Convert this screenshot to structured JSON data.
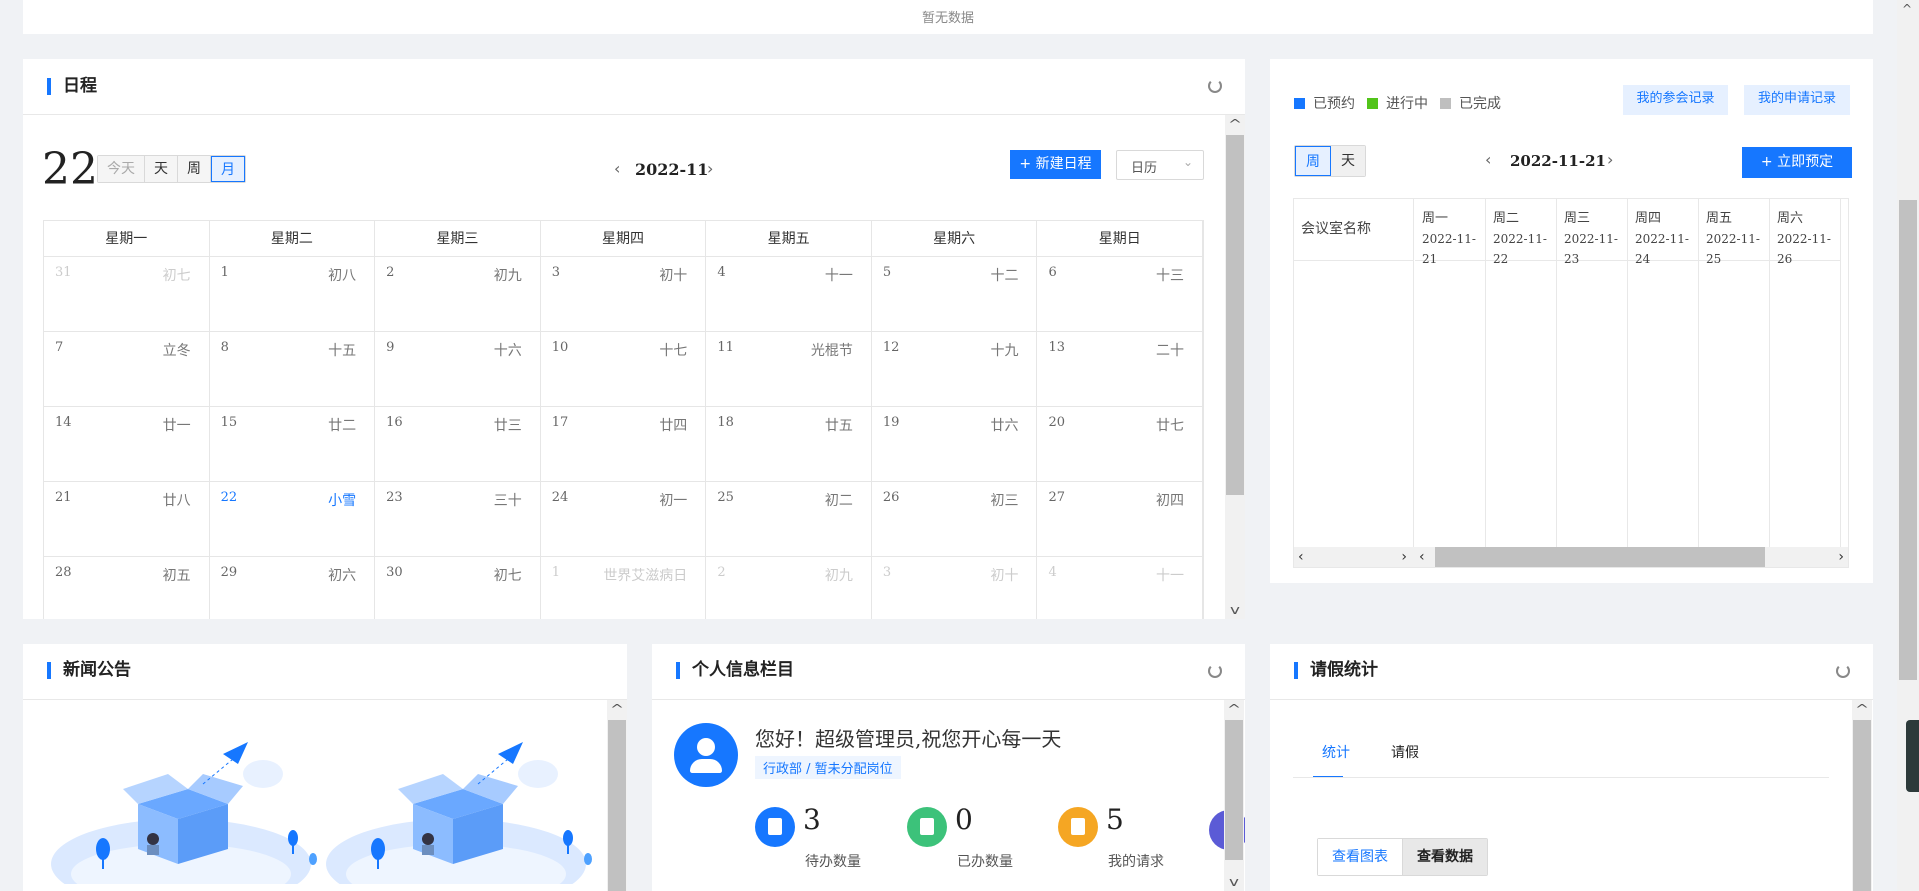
{
  "top_panel": {
    "empty_text": "暂无数据"
  },
  "schedule": {
    "title": "日程",
    "big_day": "22",
    "view_buttons": [
      "今天",
      "天",
      "周",
      "月"
    ],
    "active_view": "月",
    "month": "2022-11",
    "new_button": "+ 新建日程",
    "mode_select": "日历",
    "weekdays": [
      "星期一",
      "星期二",
      "星期三",
      "星期四",
      "星期五",
      "星期六",
      "星期日"
    ],
    "weeks": [
      [
        {
          "d": "31",
          "l": "初七",
          "o": true
        },
        {
          "d": "1",
          "l": "初八"
        },
        {
          "d": "2",
          "l": "初九"
        },
        {
          "d": "3",
          "l": "初十"
        },
        {
          "d": "4",
          "l": "十一"
        },
        {
          "d": "5",
          "l": "十二"
        },
        {
          "d": "6",
          "l": "十三"
        }
      ],
      [
        {
          "d": "7",
          "l": "立冬"
        },
        {
          "d": "8",
          "l": "十五"
        },
        {
          "d": "9",
          "l": "十六"
        },
        {
          "d": "10",
          "l": "十七"
        },
        {
          "d": "11",
          "l": "光棍节"
        },
        {
          "d": "12",
          "l": "十九"
        },
        {
          "d": "13",
          "l": "二十"
        }
      ],
      [
        {
          "d": "14",
          "l": "廿一"
        },
        {
          "d": "15",
          "l": "廿二"
        },
        {
          "d": "16",
          "l": "廿三"
        },
        {
          "d": "17",
          "l": "廿四"
        },
        {
          "d": "18",
          "l": "廿五"
        },
        {
          "d": "19",
          "l": "廿六"
        },
        {
          "d": "20",
          "l": "廿七"
        }
      ],
      [
        {
          "d": "21",
          "l": "廿八"
        },
        {
          "d": "22",
          "l": "小雪",
          "t": true
        },
        {
          "d": "23",
          "l": "三十"
        },
        {
          "d": "24",
          "l": "初一"
        },
        {
          "d": "25",
          "l": "初二"
        },
        {
          "d": "26",
          "l": "初三"
        },
        {
          "d": "27",
          "l": "初四"
        }
      ],
      [
        {
          "d": "28",
          "l": "初五"
        },
        {
          "d": "29",
          "l": "初六"
        },
        {
          "d": "30",
          "l": "初七"
        },
        {
          "d": "1",
          "l": "世界艾滋病日",
          "o": true
        },
        {
          "d": "2",
          "l": "初九",
          "o": true
        },
        {
          "d": "3",
          "l": "初十",
          "o": true
        },
        {
          "d": "4",
          "l": "十一",
          "o": true
        }
      ]
    ]
  },
  "meeting": {
    "legend": [
      {
        "label": "已预约",
        "color": "#1677ff"
      },
      {
        "label": "进行中",
        "color": "#52c41a"
      },
      {
        "label": "已完成",
        "color": "#bfbfbf"
      }
    ],
    "my_attend_button": "我的参会记录",
    "my_apply_button": "我的申请记录",
    "view_buttons": [
      "周",
      "天"
    ],
    "date": "2022-11-21",
    "book_button": "+ 立即预定",
    "room_col": "会议室名称",
    "days": [
      {
        "w": "周一",
        "d": "2022-11-21"
      },
      {
        "w": "周二",
        "d": "2022-11-22"
      },
      {
        "w": "周三",
        "d": "2022-11-23"
      },
      {
        "w": "周四",
        "d": "2022-11-24"
      },
      {
        "w": "周五",
        "d": "2022-11-25"
      },
      {
        "w": "周六",
        "d": "2022-11-26"
      }
    ]
  },
  "news": {
    "title": "新闻公告"
  },
  "profile": {
    "title": "个人信息栏目",
    "greeting": "您好！超级管理员,祝您开心每一天",
    "dept": "行政部 / 暂未分配岗位",
    "stats": [
      {
        "num": "3",
        "label": "待办数量",
        "color": "#1677ff"
      },
      {
        "num": "0",
        "label": "已办数量",
        "color": "#3cc27a"
      },
      {
        "num": "5",
        "label": "我的请求",
        "color": "#f5a623"
      }
    ]
  },
  "leave": {
    "title": "请假统计",
    "tabs": [
      "统计",
      "请假"
    ],
    "view_chart": "查看图表",
    "view_data": "查看数据"
  },
  "colors": {
    "accent": "#1677ff"
  }
}
